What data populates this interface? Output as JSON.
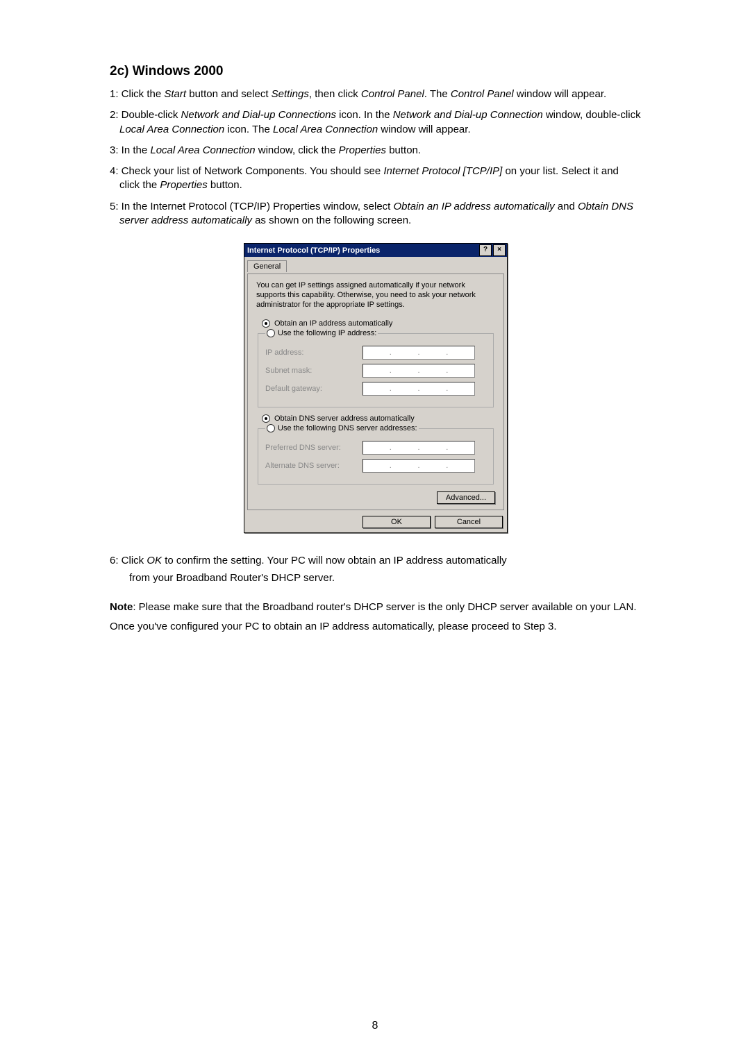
{
  "heading": "2c) Windows 2000",
  "steps": {
    "s1a": "1: Click the ",
    "s1b": "Start",
    "s1c": " button and select ",
    "s1d": "Settings",
    "s1e": ", then click ",
    "s1f": "Control Panel",
    "s1g": ". The ",
    "s1h": "Control Panel",
    "s1i": " window will appear.",
    "s2a": "2: Double-click ",
    "s2b": "Network and Dial-up Connections",
    "s2c": " icon. In the ",
    "s2d": "Network and Dial-up  Connection",
    "s2e": " window, double-click ",
    "s2f": "Local Area Connection",
    "s2g": " icon. The ",
    "s2h": "Local Area Connection",
    "s2i": " window will appear.",
    "s3a": "3: In the ",
    "s3b": "Local Area Connection",
    "s3c": " window, click the ",
    "s3d": "Properties",
    "s3e": " button.",
    "s4a": "4: Check your list of Network Components. You should see ",
    "s4b": "Internet Protocol [TCP/IP]",
    "s4c": " on your list. Select it and click the ",
    "s4d": "Properties",
    "s4e": " button.",
    "s5a": "5: In the Internet Protocol (TCP/IP) Properties window, select ",
    "s5b": "Obtain an IP address  automatically",
    "s5c": " and ",
    "s5d": "Obtain DNS server address automatically",
    "s5e": " as shown on the following screen.",
    "s6a": "6: Click ",
    "s6b": "OK",
    "s6c": " to confirm the setting. Your PC will now obtain an IP address automatically",
    "s6d": "from your Broadband Router's DHCP server."
  },
  "note": {
    "label": "Note",
    "rest": ": Please make sure that the Broadband router's DHCP server is the only DHCP server available on your LAN."
  },
  "closing": "Once you've configured your PC to obtain an IP address automatically, please proceed to Step 3.",
  "dialog": {
    "title": "Internet Protocol (TCP/IP) Properties",
    "help": "?",
    "close": "×",
    "tab": "General",
    "desc": "You can get IP settings assigned automatically if your network supports this capability. Otherwise, you need to ask your network administrator for the appropriate IP settings.",
    "r_ip_auto": "Obtain an IP address automatically",
    "r_ip_manual": "Use the following IP address:",
    "lbl_ip": "IP address:",
    "lbl_subnet": "Subnet mask:",
    "lbl_gateway": "Default gateway:",
    "r_dns_auto": "Obtain DNS server address automatically",
    "r_dns_manual": "Use the following DNS server addresses:",
    "lbl_pref": "Preferred DNS server:",
    "lbl_alt": "Alternate DNS server:",
    "advanced": "Advanced...",
    "ok": "OK",
    "cancel": "Cancel"
  },
  "page_number": "8"
}
